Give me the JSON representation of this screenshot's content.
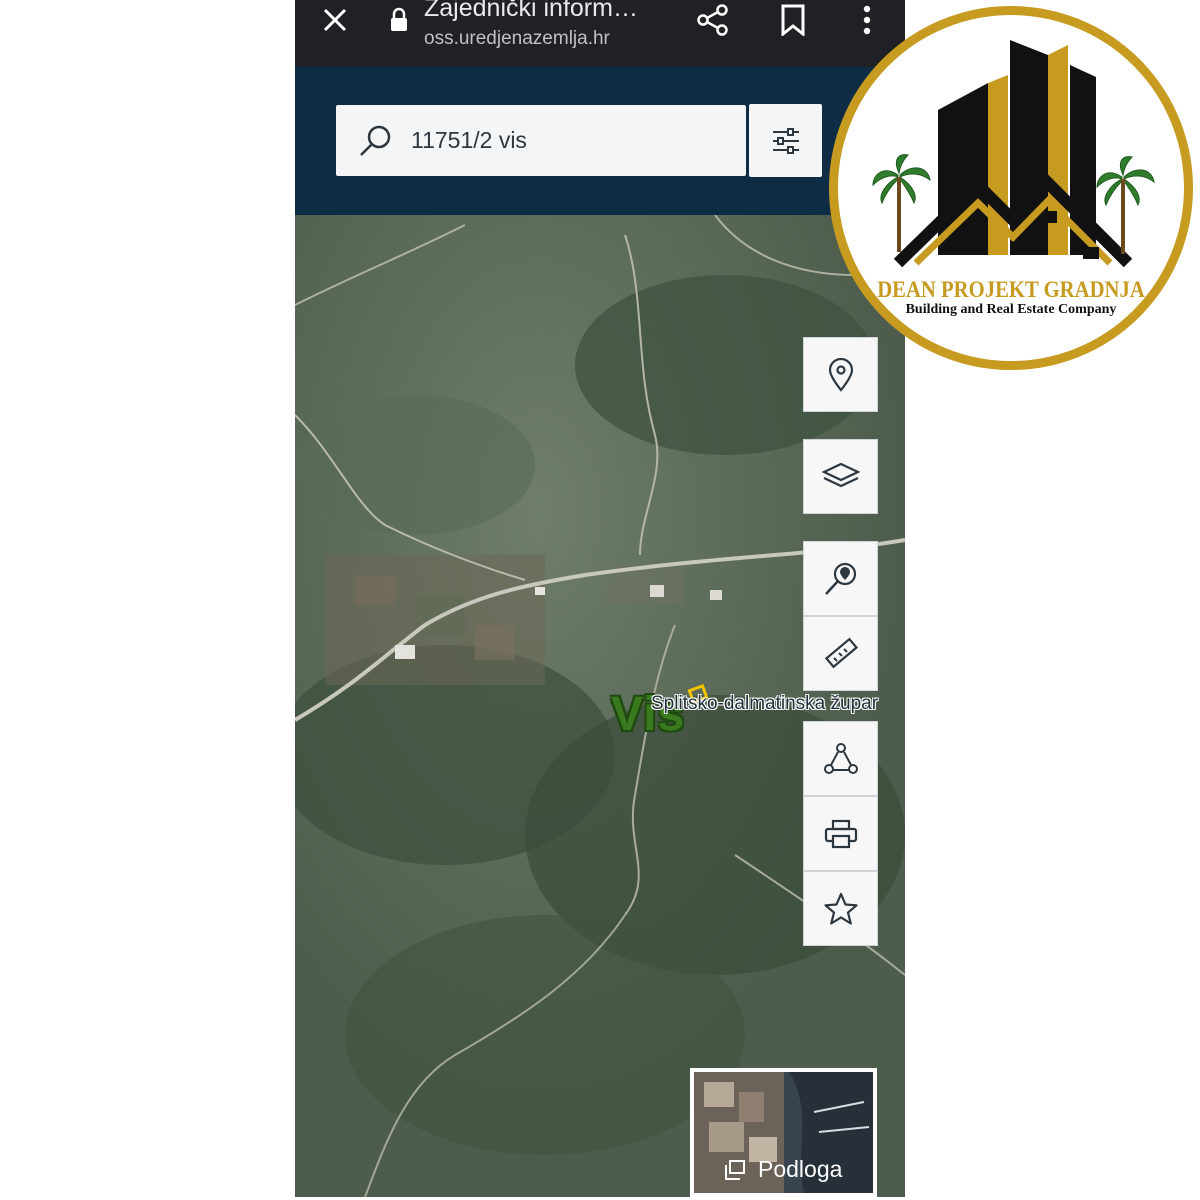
{
  "browser": {
    "title": "Zajednički inform…",
    "url": "oss.uredjenazemlja.hr"
  },
  "search": {
    "value": "11751/2 vis"
  },
  "map": {
    "place_label": "Vis",
    "region_label": "Splitsko-dalmatinska župar",
    "basemap_label": "Podloga"
  },
  "tools": [
    "location-pin-icon",
    "layers-icon",
    "search-location-icon",
    "ruler-icon",
    "polygon-icon",
    "print-icon",
    "star-icon"
  ],
  "logo": {
    "name": "DEAN PROJEKT GRADNJA",
    "tagline": "Building and Real Estate Company"
  },
  "colors": {
    "header": "#0e2c43",
    "browser_bar": "#202124",
    "logo_gold": "#c79a20"
  }
}
